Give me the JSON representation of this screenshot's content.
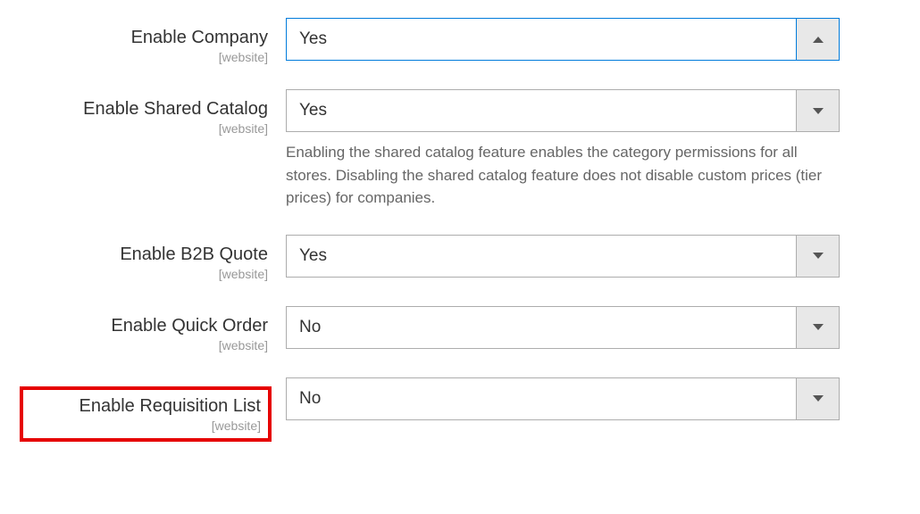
{
  "scope_label": "[website]",
  "fields": {
    "enable_company": {
      "label": "Enable Company",
      "value": "Yes"
    },
    "enable_shared_catalog": {
      "label": "Enable Shared Catalog",
      "value": "Yes",
      "help": "Enabling the shared catalog feature enables the category permissions for all stores. Disabling the shared catalog feature does not disable custom prices (tier prices) for companies."
    },
    "enable_b2b_quote": {
      "label": "Enable B2B Quote",
      "value": "Yes"
    },
    "enable_quick_order": {
      "label": "Enable Quick Order",
      "value": "No"
    },
    "enable_requisition_list": {
      "label": "Enable Requisition List",
      "value": "No"
    }
  }
}
